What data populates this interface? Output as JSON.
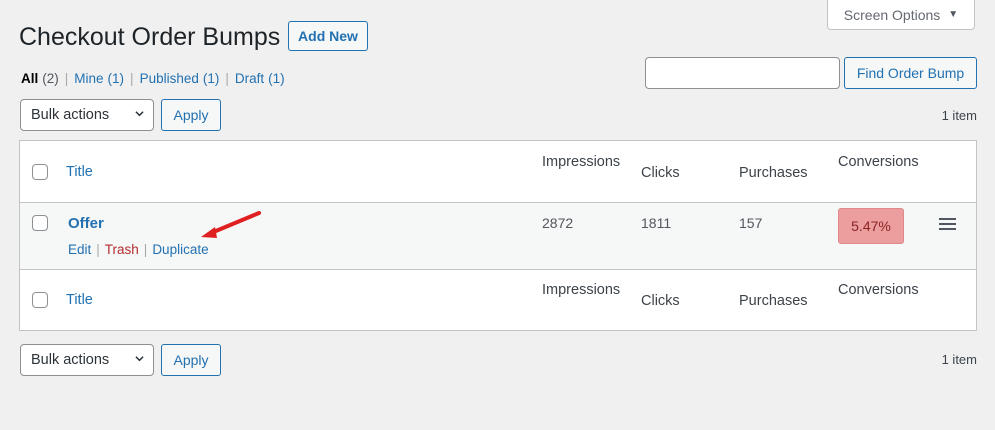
{
  "screen_options": {
    "label": "Screen Options"
  },
  "header": {
    "title": "Checkout Order Bumps",
    "add_new_label": "Add New"
  },
  "filters": {
    "all": {
      "label": "All",
      "count": "(2)"
    },
    "mine": {
      "label": "Mine",
      "count": "(1)"
    },
    "published": {
      "label": "Published",
      "count": "(1)"
    },
    "draft": {
      "label": "Draft",
      "count": "(1)"
    },
    "separator": "|"
  },
  "search": {
    "value": "",
    "button_label": "Find Order Bump"
  },
  "bulk_top": {
    "select_value": "Bulk actions",
    "apply_label": "Apply",
    "count": "1 item"
  },
  "bulk_bottom": {
    "select_value": "Bulk actions",
    "apply_label": "Apply",
    "count": "1 item"
  },
  "table": {
    "headers": {
      "title": "Title",
      "impressions": "Impressions",
      "clicks": "Clicks",
      "purchases": "Purchases",
      "conversions": "Conversions"
    },
    "rows": [
      {
        "title": "Offer",
        "actions": {
          "edit": "Edit",
          "trash": "Trash",
          "duplicate": "Duplicate",
          "separator": "|"
        },
        "impressions": "2872",
        "clicks": "1811",
        "purchases": "157",
        "conversion": "5.47%"
      }
    ]
  },
  "colors": {
    "accent": "#2271b1",
    "trash": "#b32d2e",
    "conversion_badge_bg": "#ec9e9f",
    "annotation_arrow": "#e02020"
  },
  "icons": {
    "screen_options_caret": "caret-down-icon",
    "select_chevron": "chevron-down-icon",
    "drag_handle": "menu-icon",
    "annotation": "arrow-icon"
  }
}
